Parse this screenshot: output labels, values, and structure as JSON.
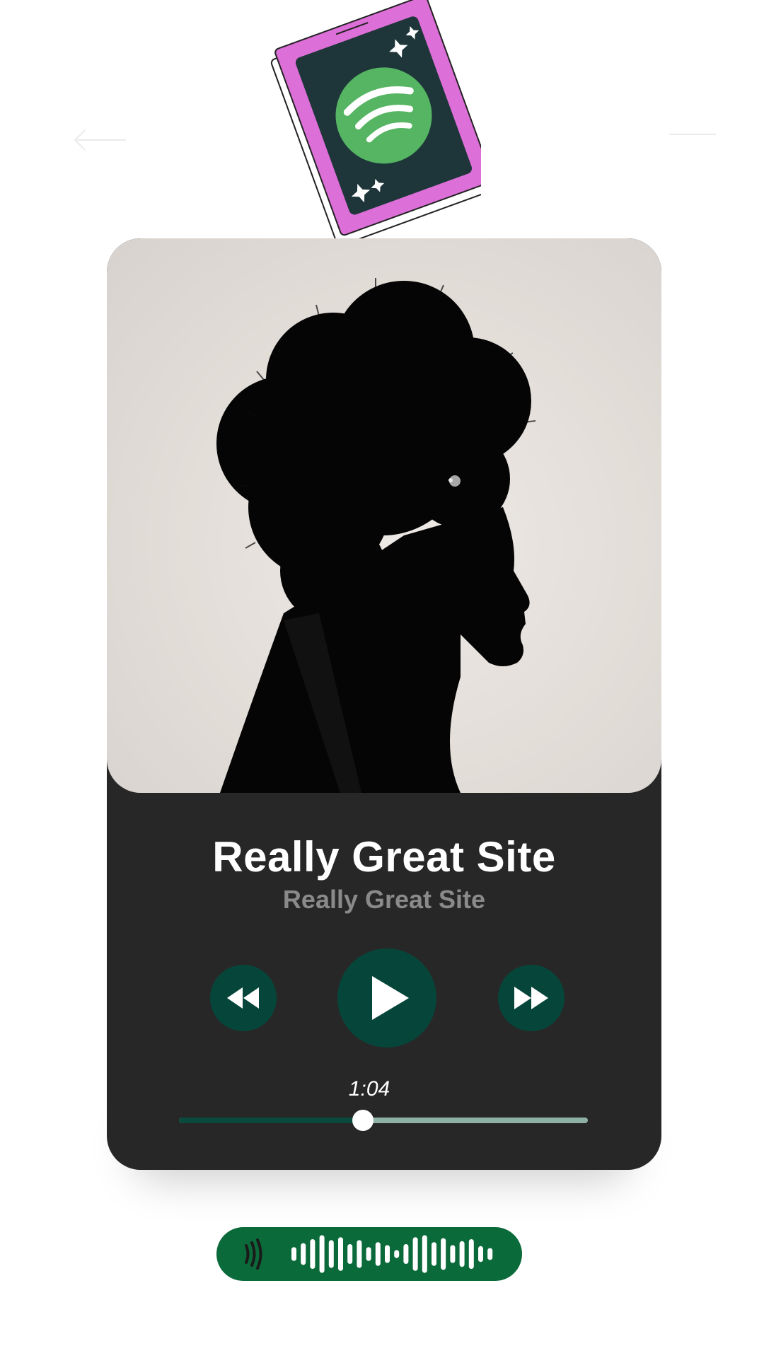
{
  "colors": {
    "card_bg": "#272727",
    "control_bg": "#06463a",
    "progress_played": "#0a4a3c",
    "progress_remaining": "#8fb0a4",
    "sticker_frame": "#dd6fd8",
    "sticker_inner": "#1e3639",
    "spotify_green": "#55b563",
    "code_pill": "#0b6a3a"
  },
  "icons": {
    "logo": "spotify-icon",
    "back": "arrow-left-icon",
    "forward": "arrow-right-icon",
    "prev": "rewind-icon",
    "play": "play-icon",
    "next": "fast-forward-icon"
  },
  "track": {
    "title": "Really Great Site",
    "artist": "Really Great Site"
  },
  "playback": {
    "elapsed": "1:04",
    "progress": 0.45
  },
  "code_bars": [
    0.35,
    0.55,
    0.75,
    0.95,
    0.7,
    0.85,
    0.5,
    0.7,
    0.35,
    0.6,
    0.45,
    0.2,
    0.5,
    0.85,
    0.95,
    0.6,
    0.8,
    0.45,
    0.65,
    0.75,
    0.4,
    0.3
  ]
}
